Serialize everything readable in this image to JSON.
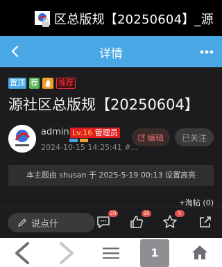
{
  "window": {
    "title": "区总版规【20250604】_源"
  },
  "navbar": {
    "title": "详情"
  },
  "thread": {
    "badges": [
      "置顶",
      "荐",
      "推荐"
    ],
    "title": "源社区总版规【20250604】",
    "author": "admin",
    "level_lv": "Lv.16",
    "level_role": "管理员",
    "date": "2024-10-15 14:25:41 #...",
    "edit_label": "编辑",
    "follow_label": "已关注",
    "notice": "本主题由 shusan 于 2025-5-19 00:13 设置高亮",
    "add_tag": "+淘帖 (0)"
  },
  "bottom": {
    "comment_placeholder": "说点什",
    "comments_count": "20",
    "likes_count": "35",
    "favorites_count": "5"
  },
  "browser": {
    "tab_count": "1"
  },
  "colors": {
    "accent": "#4aa7e6",
    "danger": "#e02020"
  }
}
